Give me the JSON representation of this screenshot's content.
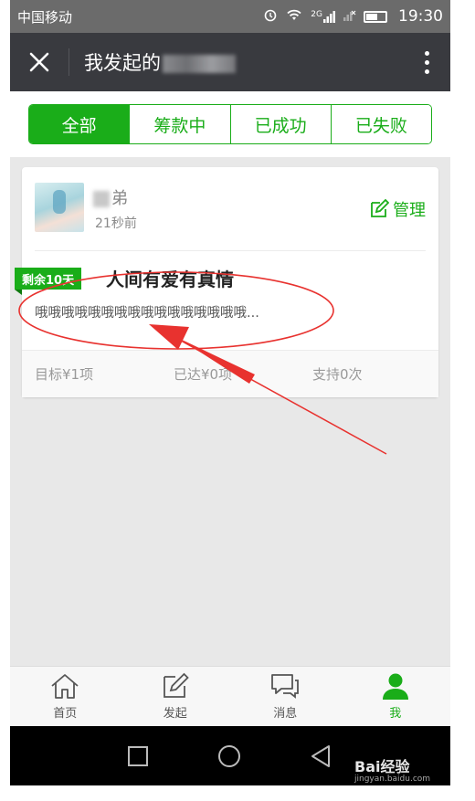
{
  "status": {
    "carrier": "中国移动",
    "signal_label": "2G",
    "time": "19:30"
  },
  "nav": {
    "title": "我发起的"
  },
  "tabs": [
    {
      "label": "全部",
      "active": true
    },
    {
      "label": "筹款中",
      "active": false
    },
    {
      "label": "已成功",
      "active": false
    },
    {
      "label": "已失败",
      "active": false
    }
  ],
  "card": {
    "user_name": "弟",
    "time_ago": "21秒前",
    "manage_label": "管理",
    "badge": "剩余10天",
    "title": "人间有爱有真情",
    "description": "哦哦哦哦哦哦哦哦哦哦哦哦哦哦哦哦...",
    "stats": {
      "target": "目标¥1项",
      "reached": "已达¥0项",
      "support": "支持0次"
    }
  },
  "bottom_tabs": [
    {
      "label": "首页",
      "icon": "home-icon",
      "active": false
    },
    {
      "label": "发起",
      "icon": "edit-icon",
      "active": false
    },
    {
      "label": "消息",
      "icon": "chat-icon",
      "active": false
    },
    {
      "label": "我",
      "icon": "user-icon",
      "active": true
    }
  ],
  "watermark": {
    "brand": "Bai经验",
    "url": "jingyan.baidu.com"
  },
  "colors": {
    "accent": "#1aad19",
    "navbar": "#393a3f",
    "annotation": "#e8322f"
  }
}
